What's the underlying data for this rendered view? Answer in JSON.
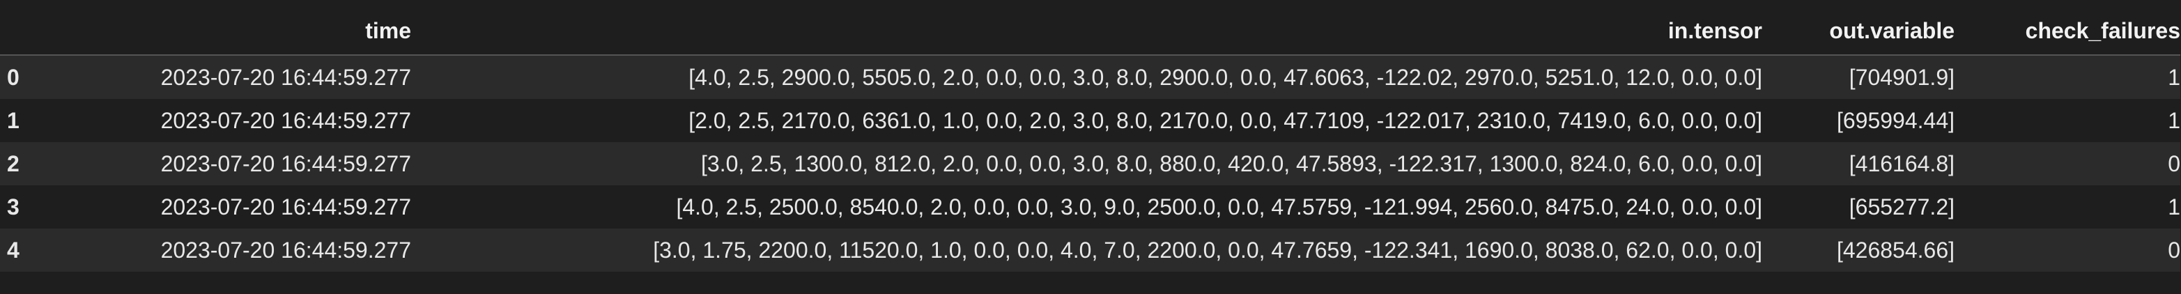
{
  "table": {
    "columns": {
      "index": "",
      "time": "time",
      "in_tensor": "in.tensor",
      "out_variable": "out.variable",
      "check_failures": "check_failures"
    },
    "rows": [
      {
        "index": "0",
        "time": "2023-07-20 16:44:59.277",
        "in_tensor": "[4.0, 2.5, 2900.0, 5505.0, 2.0, 0.0, 0.0, 3.0, 8.0, 2900.0, 0.0, 47.6063, -122.02, 2970.0, 5251.0, 12.0, 0.0, 0.0]",
        "out_variable": "[704901.9]",
        "check_failures": "1"
      },
      {
        "index": "1",
        "time": "2023-07-20 16:44:59.277",
        "in_tensor": "[2.0, 2.5, 2170.0, 6361.0, 1.0, 0.0, 2.0, 3.0, 8.0, 2170.0, 0.0, 47.7109, -122.017, 2310.0, 7419.0, 6.0, 0.0, 0.0]",
        "out_variable": "[695994.44]",
        "check_failures": "1"
      },
      {
        "index": "2",
        "time": "2023-07-20 16:44:59.277",
        "in_tensor": "[3.0, 2.5, 1300.0, 812.0, 2.0, 0.0, 0.0, 3.0, 8.0, 880.0, 420.0, 47.5893, -122.317, 1300.0, 824.0, 6.0, 0.0, 0.0]",
        "out_variable": "[416164.8]",
        "check_failures": "0"
      },
      {
        "index": "3",
        "time": "2023-07-20 16:44:59.277",
        "in_tensor": "[4.0, 2.5, 2500.0, 8540.0, 2.0, 0.0, 0.0, 3.0, 9.0, 2500.0, 0.0, 47.5759, -121.994, 2560.0, 8475.0, 24.0, 0.0, 0.0]",
        "out_variable": "[655277.2]",
        "check_failures": "1"
      },
      {
        "index": "4",
        "time": "2023-07-20 16:44:59.277",
        "in_tensor": "[3.0, 1.75, 2200.0, 11520.0, 1.0, 0.0, 0.0, 4.0, 7.0, 2200.0, 0.0, 47.7659, -122.341, 1690.0, 8038.0, 62.0, 0.0, 0.0]",
        "out_variable": "[426854.66]",
        "check_failures": "0"
      }
    ]
  },
  "colors": {
    "background": "#1e1e1e",
    "row_stripe": "#2b2b2b",
    "text": "#e8e8e8",
    "header_rule": "#555555"
  }
}
